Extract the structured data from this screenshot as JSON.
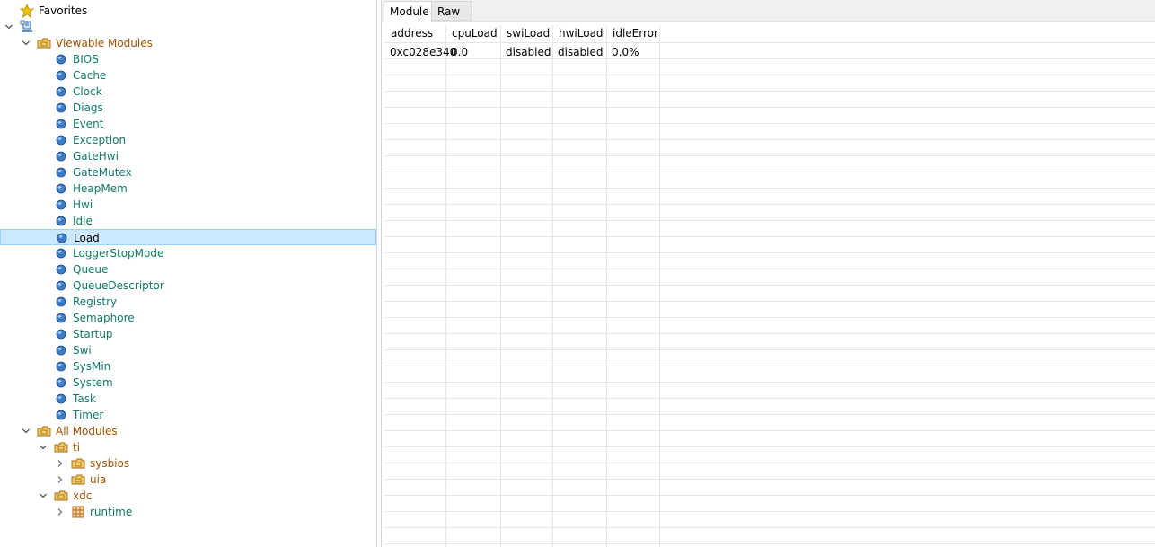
{
  "tree": {
    "favorites_label": "Favorites",
    "viewable_modules": {
      "label": "Viewable Modules",
      "items": [
        "BIOS",
        "Cache",
        "Clock",
        "Diags",
        "Event",
        "Exception",
        "GateHwi",
        "GateMutex",
        "HeapMem",
        "Hwi",
        "Idle",
        "Load",
        "LoggerStopMode",
        "Queue",
        "QueueDescriptor",
        "Registry",
        "Semaphore",
        "Startup",
        "Swi",
        "SysMin",
        "System",
        "Task",
        "Timer"
      ],
      "selected": "Load"
    },
    "all_modules": {
      "label": "All Modules",
      "ti": {
        "label": "ti",
        "children": [
          "sysbios",
          "uia"
        ]
      },
      "xdc": {
        "label": "xdc",
        "children": [
          "runtime"
        ]
      }
    }
  },
  "tabs": [
    {
      "label": "Module",
      "active": true
    },
    {
      "label": "Raw",
      "active": false
    }
  ],
  "table": {
    "columns": [
      "address",
      "cpuLoad",
      "swiLoad",
      "hwiLoad",
      "idleError"
    ],
    "rows": [
      [
        "0xc028e340",
        "0.0",
        "disabled",
        "disabled",
        "0.0%"
      ]
    ]
  },
  "colors": {
    "module_text": "#0f7a6a",
    "package_text": "#a35200",
    "selection_bg": "#cce8ff",
    "selection_border": "#99d1ff"
  }
}
